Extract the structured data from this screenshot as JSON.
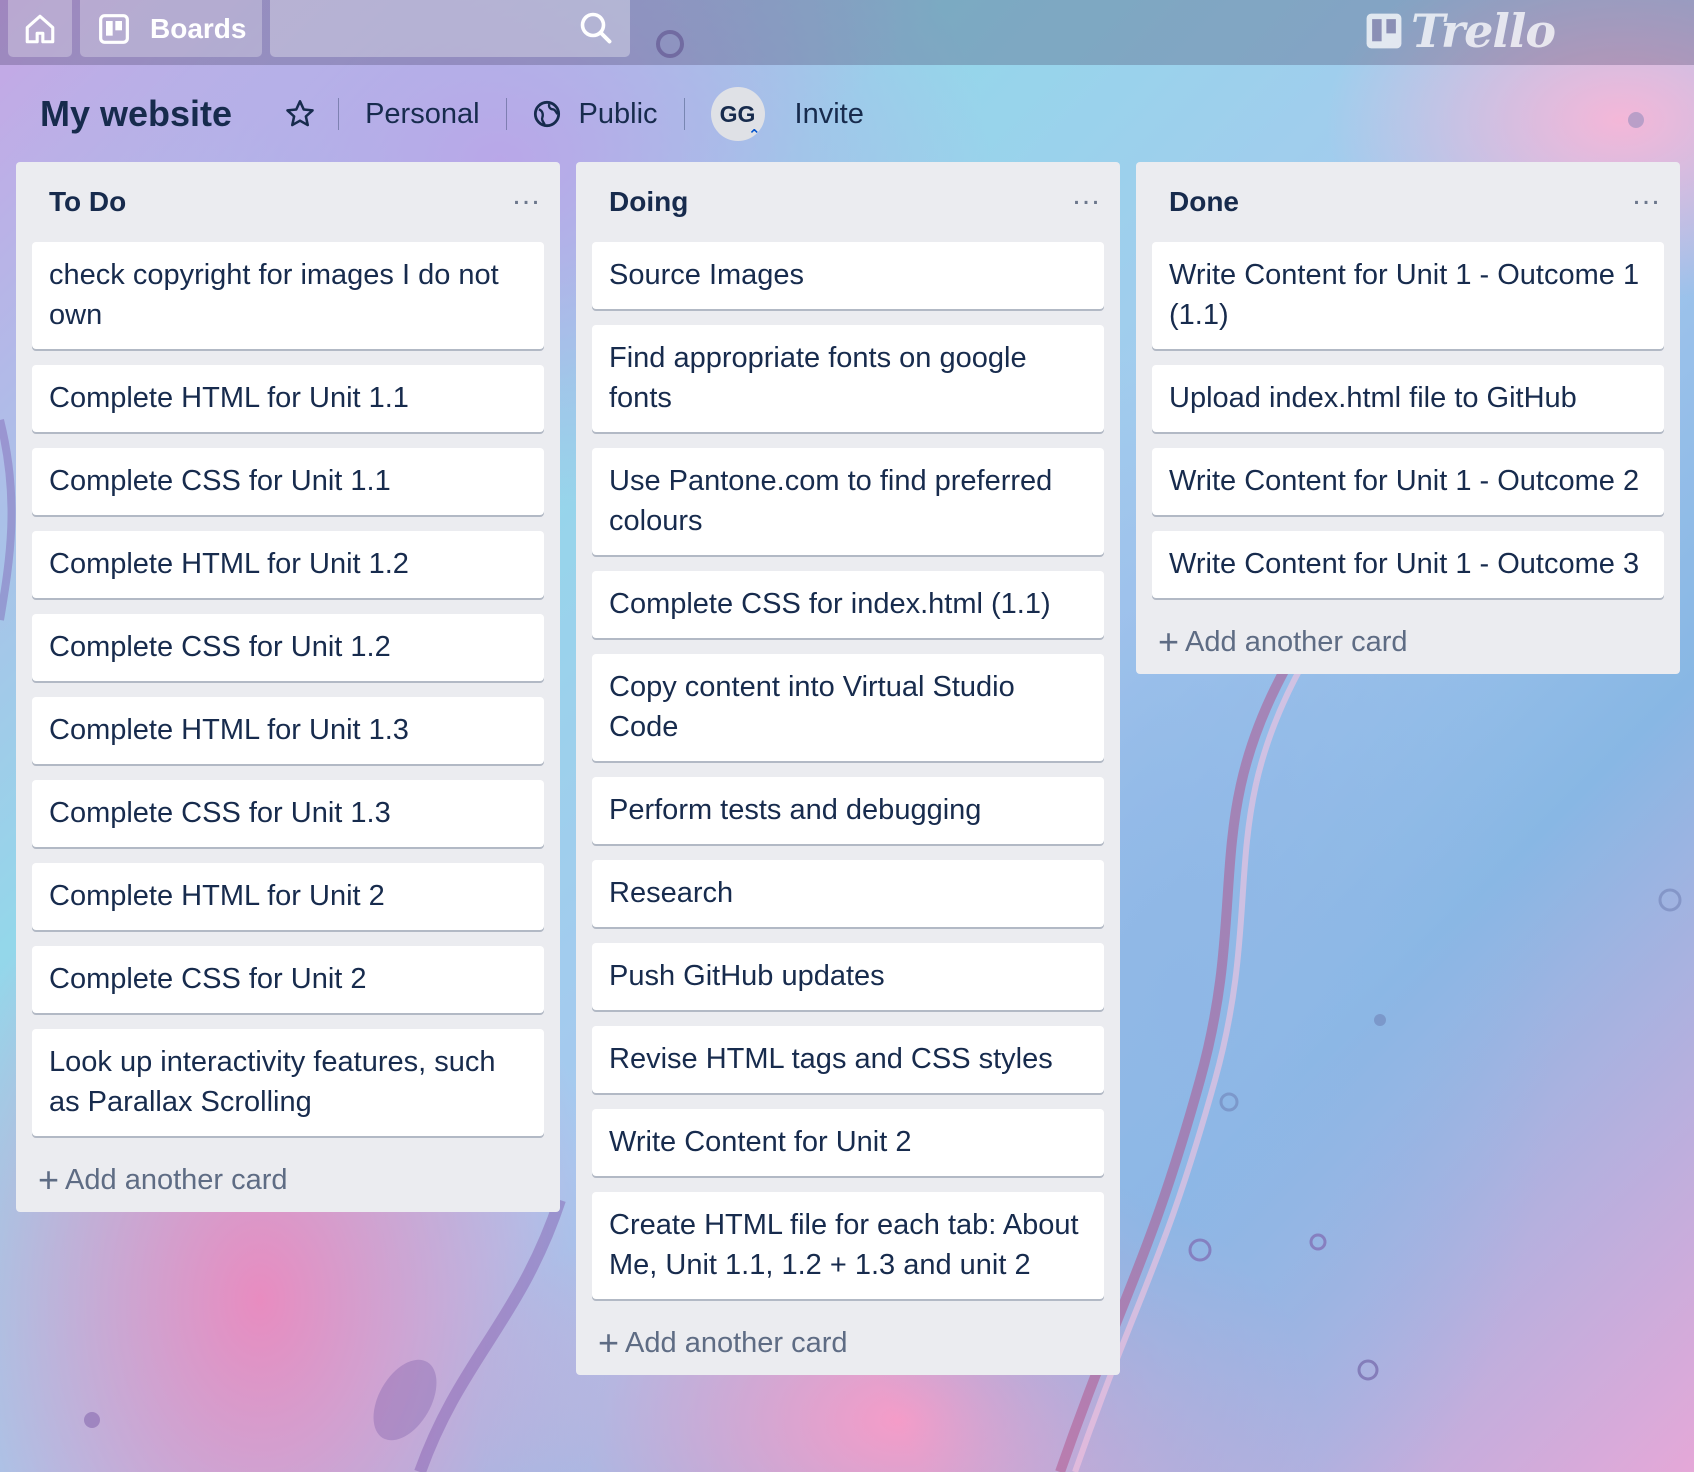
{
  "topbar": {
    "boards_label": "Boards",
    "logo_text": "Trello"
  },
  "board": {
    "title": "My website",
    "visibility_team": "Personal",
    "visibility": "Public",
    "avatar_initials": "GG",
    "invite_label": "Invite"
  },
  "lists": [
    {
      "title": "To Do",
      "cards": [
        "check copyright for images I do not own",
        "Complete HTML for Unit 1.1",
        "Complete CSS for Unit 1.1",
        "Complete HTML for Unit 1.2",
        "Complete CSS for Unit 1.2",
        "Complete HTML for Unit 1.3",
        "Complete CSS for Unit 1.3",
        "Complete HTML for Unit 2",
        "Complete CSS for Unit 2",
        "Look up interactivity features, such as Parallax Scrolling"
      ],
      "add_label": "Add another card"
    },
    {
      "title": "Doing",
      "cards": [
        "Source Images",
        "Find appropriate fonts on google fonts",
        "Use Pantone.com to find preferred colours",
        "Complete CSS for index.html (1.1)",
        "Copy content into Virtual Studio Code",
        "Perform tests and debugging",
        "Research",
        "Push GitHub updates",
        "Revise HTML tags and CSS styles",
        "Write Content for Unit 2",
        "Create HTML file for each tab: About Me, Unit 1.1, 1.2 + 1.3 and unit 2"
      ],
      "add_label": "Add another card"
    },
    {
      "title": "Done",
      "cards": [
        "Write Content for Unit 1 - Outcome 1 (1.1)",
        "Upload index.html file to GitHub",
        "Write Content for Unit 1 - Outcome 2",
        "Write Content for Unit 1 - Outcome 3"
      ],
      "add_label": "Add another card"
    }
  ],
  "colors": {
    "list_bg": "#ebecf0",
    "text": "#172b4d",
    "muted": "#5e6c84"
  }
}
